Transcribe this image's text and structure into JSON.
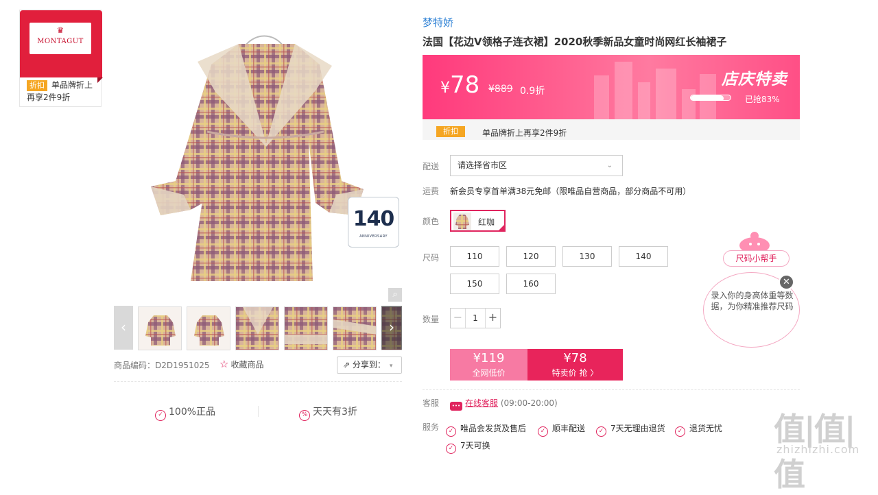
{
  "brand_badge": {
    "logo_text": "MONTAGUT",
    "tag": "折扣",
    "tag_text_line1": "单品牌折上",
    "tag_text_line2": "再享2件9折"
  },
  "gallery": {
    "anniversary_number": "140",
    "anniversary_text": "ANNIVERSARY",
    "product_code_label": "商品编码：D2D1951025",
    "favorite_label": "收藏商品",
    "share_label": "分享到：",
    "promises": [
      "100%正品",
      "天天有3折"
    ]
  },
  "product": {
    "brand_name": "梦特娇",
    "title": "法国【花边V领格子连衣裙】2020秋季新品女童时尚网红长袖裙子"
  },
  "price_banner": {
    "currency": "¥",
    "price": "78",
    "original_price": "¥889",
    "discount": "0.9折",
    "event_title": "店庆特卖",
    "sold_text": "已抢83%",
    "sold_fraction": 0.83
  },
  "discount_strip": {
    "tag": "折扣",
    "text": "单品牌折上再享2件9折"
  },
  "options": {
    "delivery_label": "配送",
    "delivery_placeholder": "请选择省市区",
    "shipping_label": "运费",
    "shipping_text": "新会员专享首单满38元免邮（限唯品自营商品，部分商品不可用）",
    "color_label": "颜色",
    "color_value": "红咖",
    "size_label": "尺码",
    "sizes": [
      "110",
      "120",
      "130",
      "140",
      "150",
      "160"
    ],
    "qty_label": "数量",
    "qty_value": "1"
  },
  "buy": {
    "low_price": "¥119",
    "low_label": "全网低价",
    "sale_price": "¥78",
    "sale_label": "特卖价 抢 〉"
  },
  "service": {
    "cs_label": "客服",
    "cs_link": "在线客服",
    "cs_hours": "(09:00-20:00)",
    "service_label": "服务",
    "items": [
      "唯品会发货及售后",
      "顺丰配送",
      "7天无理由退货",
      "退货无忧",
      "7天可换"
    ]
  },
  "size_helper": {
    "title": "尺码小帮手",
    "text": "录入你的身高体重等数据，为你精准推荐尺码"
  },
  "watermark": {
    "logo": "值|值|值",
    "url": "zhizhizhi.com"
  },
  "colors": {
    "accent": "#e0245e",
    "brand_blue": "#2a7fd4",
    "discount_orange": "#f5a623"
  }
}
